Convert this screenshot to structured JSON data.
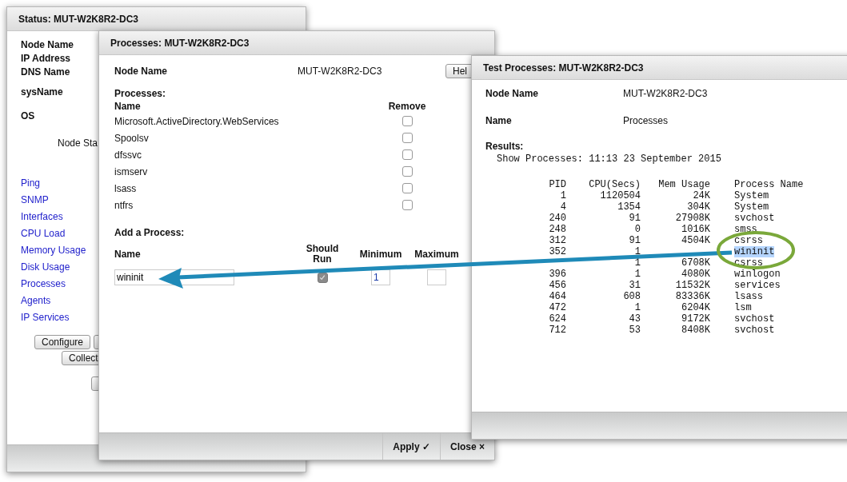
{
  "status_window": {
    "title": "Status: MUT-W2K8R2-DC3",
    "fields": [
      {
        "label": "Node Name"
      },
      {
        "label": "IP Address"
      },
      {
        "label": "DNS Name"
      },
      {
        "label": "sysName"
      },
      {
        "label": "OS"
      }
    ],
    "node_status_label": "Node Sta",
    "links": [
      "Ping",
      "SNMP",
      "Interfaces",
      "CPU Load",
      "Memory Usage",
      "Disk Usage",
      "Processes",
      "Agents",
      "IP Services"
    ],
    "buttons": [
      {
        "label": "Configure"
      },
      {
        "label": "Collect"
      }
    ]
  },
  "processes_window": {
    "title": "Processes: MUT-W2K8R2-DC3",
    "node_name_label": "Node Name",
    "node_name_value": "MUT-W2K8R2-DC3",
    "help_button": "Hel",
    "processes_heading": "Processes:",
    "columns": [
      "Name",
      "Remove"
    ],
    "processes": [
      {
        "name": "Microsoft.ActiveDirectory.WebServices",
        "remove": false
      },
      {
        "name": "Spoolsv",
        "remove": false
      },
      {
        "name": "dfssvc",
        "remove": false
      },
      {
        "name": "ismserv",
        "remove": false
      },
      {
        "name": "lsass",
        "remove": false
      },
      {
        "name": "ntfrs",
        "remove": false
      }
    ],
    "add_heading": "Add a Process:",
    "add_columns": [
      "Name",
      "Should Run",
      "Minimum",
      "Maximum"
    ],
    "new_process": {
      "name": "wininit",
      "should_run": true,
      "should_run_disabled": true,
      "minimum": "1"
    },
    "buttons": [
      "Apply ✓",
      "Close ×"
    ]
  },
  "test_window": {
    "title": "Test Processes: MUT-W2K8R2-DC3",
    "fields": [
      {
        "label": "Node Name",
        "value": "MUT-W2K8R2-DC3"
      },
      {
        "label": "Name",
        "value": "Processes"
      }
    ],
    "results_heading": "Results:",
    "summary": "Show Processes: 11:13 23 September 2015",
    "columns": [
      "PID",
      "CPU(Secs)",
      "Mem Usage",
      "Process Name"
    ],
    "rows": [
      {
        "pid": "1",
        "cpu": "1120504",
        "mem": "24K",
        "name": "System",
        "highlighted": false
      },
      {
        "pid": "4",
        "cpu": "1354",
        "mem": "304K",
        "name": "System",
        "highlighted": false
      },
      {
        "pid": "240",
        "cpu": "91",
        "mem": "27908K",
        "name": "svchost",
        "highlighted": false
      },
      {
        "pid": "248",
        "cpu": "0",
        "mem": "1016K",
        "name": "smss",
        "highlighted": false
      },
      {
        "pid": "312",
        "cpu": "91",
        "mem": "4504K",
        "name": "csrss",
        "highlighted": false
      },
      {
        "pid": "352",
        "cpu": "1",
        "name": "wininit",
        "highlighted": true
      },
      {
        "cpu": "1",
        "mem": "6708K",
        "name": "csrss",
        "highlighted": false
      },
      {
        "pid": "396",
        "cpu": "1",
        "mem": "4080K",
        "name": "winlogon",
        "highlighted": false
      },
      {
        "pid": "456",
        "cpu": "31",
        "mem": "11532K",
        "name": "services",
        "highlighted": false
      },
      {
        "pid": "464",
        "cpu": "608",
        "mem": "83336K",
        "name": "lsass",
        "highlighted": false
      },
      {
        "pid": "472",
        "cpu": "1",
        "mem": "6204K",
        "name": "lsm",
        "highlighted": false
      },
      {
        "pid": "624",
        "cpu": "43",
        "mem": "9172K",
        "name": "svchost",
        "highlighted": false
      },
      {
        "pid": "712",
        "cpu": "53",
        "mem": "8408K",
        "name": "svchost",
        "highlighted": false
      }
    ]
  }
}
